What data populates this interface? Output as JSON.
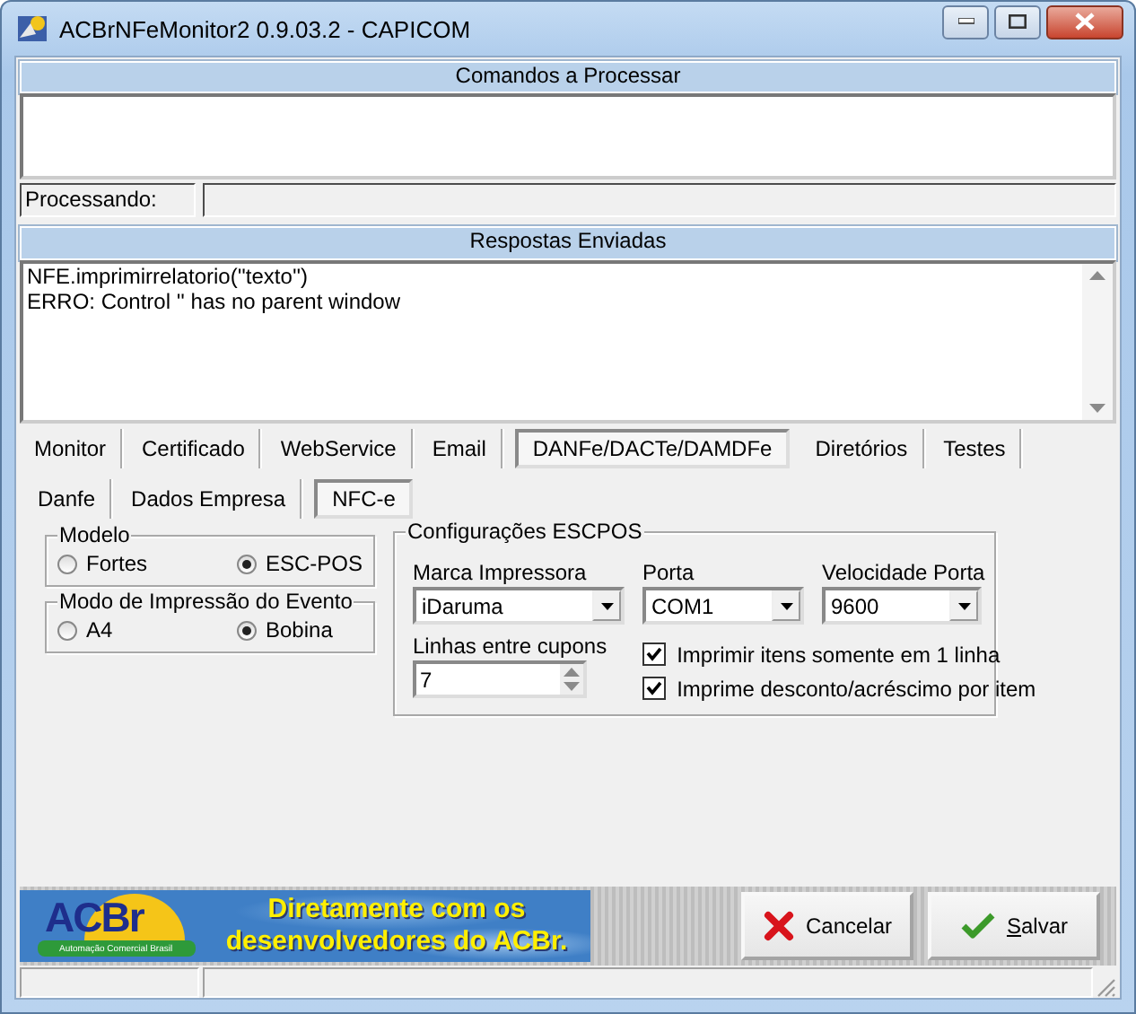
{
  "window": {
    "title": "ACBrNFeMonitor2 0.9.03.2 - CAPICOM"
  },
  "commands": {
    "header": "Comandos a Processar"
  },
  "processing": {
    "label": "Processando:"
  },
  "responses": {
    "header": "Respostas Enviadas",
    "lines": [
      "NFE.imprimirrelatorio(''texto'')",
      "ERRO: Control '' has no parent window"
    ]
  },
  "tabs": [
    {
      "label": "Monitor",
      "selected": false
    },
    {
      "label": "Certificado",
      "selected": false
    },
    {
      "label": "WebService",
      "selected": false
    },
    {
      "label": "Email",
      "selected": false
    },
    {
      "label": "DANFe/DACTe/DAMDFe",
      "selected": true
    },
    {
      "label": "Diretórios",
      "selected": false
    },
    {
      "label": "Testes",
      "selected": false
    }
  ],
  "subtabs": [
    {
      "label": "Danfe",
      "selected": false
    },
    {
      "label": "Dados Empresa",
      "selected": false
    },
    {
      "label": "NFC-e",
      "selected": true
    }
  ],
  "modelo": {
    "title": "Modelo",
    "options": [
      {
        "label": "Fortes",
        "selected": false
      },
      {
        "label": "ESC-POS",
        "selected": true
      }
    ]
  },
  "evento": {
    "title": "Modo de Impressão do Evento",
    "options": [
      {
        "label": "A4",
        "selected": false
      },
      {
        "label": "Bobina",
        "selected": true
      }
    ]
  },
  "escpos": {
    "title": "Configurações ESCPOS",
    "combos": [
      {
        "label": "Marca Impressora",
        "value": "iDaruma"
      },
      {
        "label": "Porta",
        "value": "COM1"
      },
      {
        "label": "Velocidade Porta",
        "value": "9600"
      }
    ],
    "spin": {
      "label": "Linhas entre cupons",
      "value": "7"
    },
    "checks": [
      {
        "label": "Imprimir itens somente em 1 linha",
        "checked": true
      },
      {
        "label": "Imprime desconto/acréscimo por item",
        "checked": true
      }
    ]
  },
  "banner": {
    "logo": "ACBr",
    "tagline": "Automação Comercial Brasil",
    "slogan": [
      "Diretamente com os",
      "desenvolvedores do ACBr."
    ]
  },
  "buttons": [
    {
      "label": "Cancelar",
      "kind": "cancel",
      "mnemonic": false
    },
    {
      "label": "Salvar",
      "kind": "save",
      "mnemonic": true
    }
  ]
}
